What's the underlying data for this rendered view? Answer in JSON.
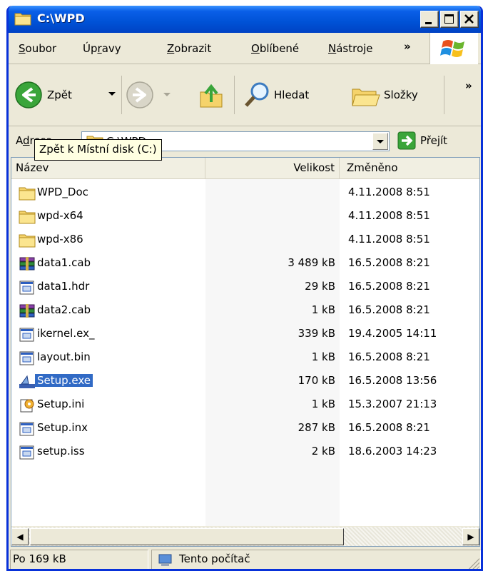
{
  "window": {
    "title": "C:\\WPD"
  },
  "menu": {
    "items": [
      {
        "label": "Soubor",
        "u": "S",
        "rest": "oubor"
      },
      {
        "label": "Úpravy",
        "pre": "Úp",
        "u": "r",
        "rest": "avy"
      },
      {
        "label": "Zobrazit",
        "u": "Z",
        "rest": "obrazit"
      },
      {
        "label": "Oblíbené",
        "u": "O",
        "rest": "blíbené"
      },
      {
        "label": "Nástroje",
        "u": "N",
        "rest": "ástroje"
      }
    ],
    "more": "»"
  },
  "toolbar": {
    "back_label": "Zpět",
    "search_label": "Hledat",
    "folders_label": "Složky",
    "more": "»"
  },
  "address": {
    "label_a": "A",
    "label_u": "d",
    "label_rest": "resa",
    "value": "C:\\WPD",
    "go_label": "Přejít"
  },
  "tooltip": "Zpět k Místní disk (C:)",
  "columns": {
    "name": "Název",
    "size": "Velikost",
    "modified": "Změněno"
  },
  "files": [
    {
      "name": "WPD_Doc",
      "size": "",
      "modified": "4.11.2008 8:51",
      "icon": "folder-icon"
    },
    {
      "name": "wpd-x64",
      "size": "",
      "modified": "4.11.2008 8:51",
      "icon": "folder-icon"
    },
    {
      "name": "wpd-x86",
      "size": "",
      "modified": "4.11.2008 8:51",
      "icon": "folder-icon"
    },
    {
      "name": "data1.cab",
      "size": "3 489 kB",
      "modified": "16.5.2008 8:21",
      "icon": "archive-icon"
    },
    {
      "name": "data1.hdr",
      "size": "29 kB",
      "modified": "16.5.2008 8:21",
      "icon": "file-icon"
    },
    {
      "name": "data2.cab",
      "size": "1 kB",
      "modified": "16.5.2008 8:21",
      "icon": "archive-icon"
    },
    {
      "name": "ikernel.ex_",
      "size": "339 kB",
      "modified": "19.4.2005 14:11",
      "icon": "file-icon"
    },
    {
      "name": "layout.bin",
      "size": "1 kB",
      "modified": "16.5.2008 8:21",
      "icon": "file-icon"
    },
    {
      "name": "Setup.exe",
      "size": "170 kB",
      "modified": "16.5.2008 13:56",
      "icon": "setup-exe-icon",
      "selected": true
    },
    {
      "name": "Setup.ini",
      "size": "1 kB",
      "modified": "15.3.2007 21:13",
      "icon": "settings-file-icon"
    },
    {
      "name": "Setup.inx",
      "size": "287 kB",
      "modified": "16.5.2008 8:21",
      "icon": "file-icon"
    },
    {
      "name": "setup.iss",
      "size": "2 kB",
      "modified": "18.6.2003 14:23",
      "icon": "file-icon"
    }
  ],
  "status": {
    "panel1": "Po 169 kB",
    "panel2": "Tento počítač"
  },
  "colors": {
    "title_blue": "#0052D6",
    "selection": "#316AC5",
    "window_bg": "#ECE9D8",
    "tooltip_bg": "#FFFFE1"
  }
}
